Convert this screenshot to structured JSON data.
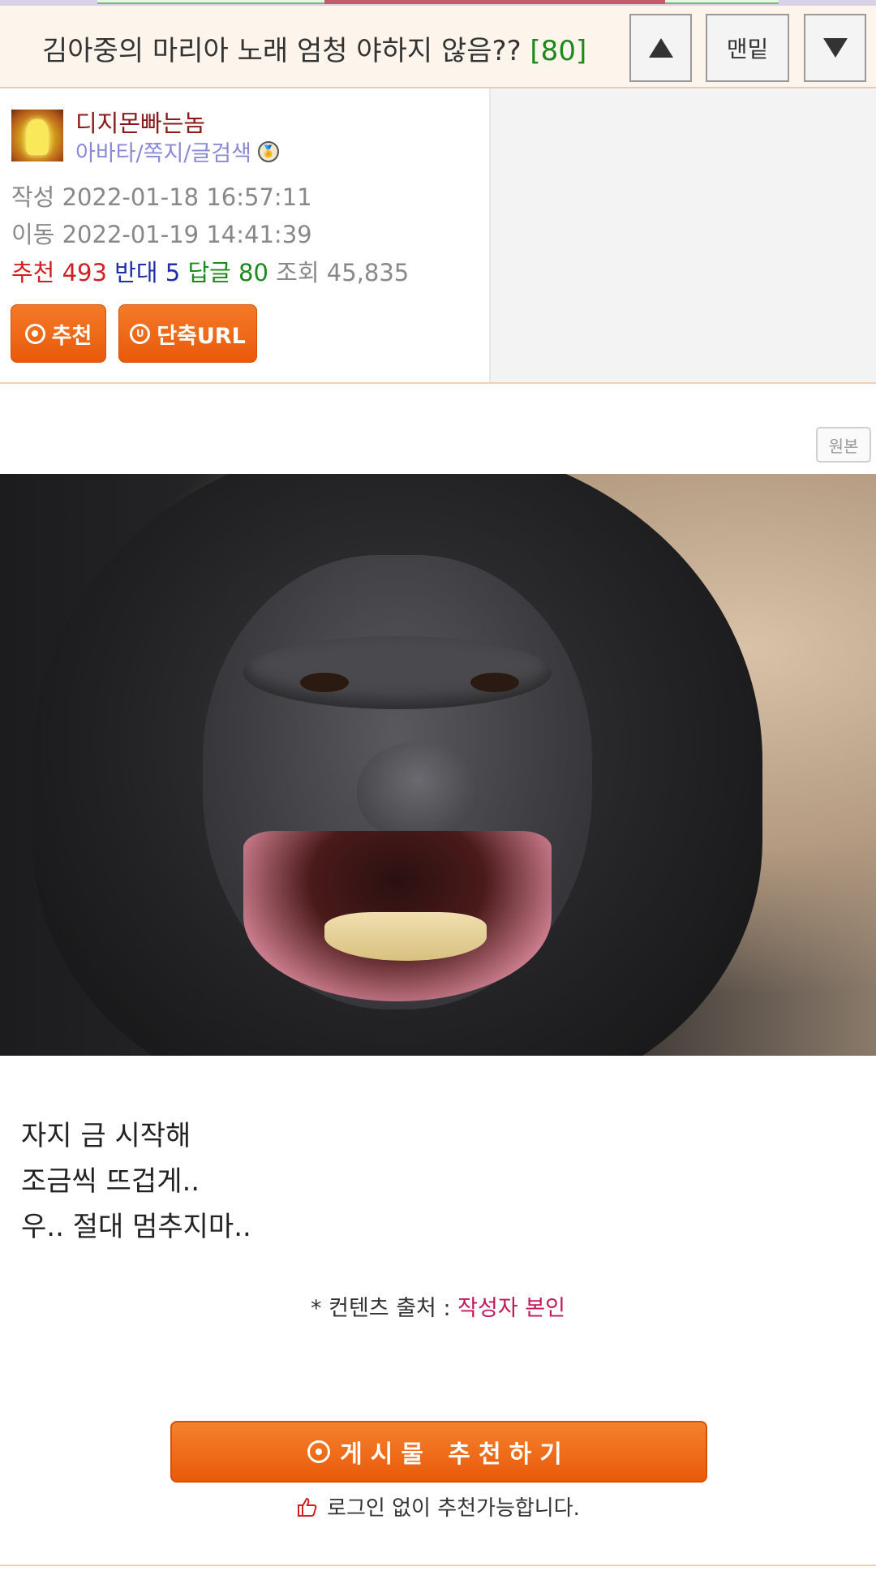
{
  "header": {
    "title": "김아중의 마리아 노래 엄청 야하지 않음??",
    "comment_count": "[80]",
    "bottom_label": "맨밑"
  },
  "author": {
    "name": "디지몬빠는놈",
    "links": "아바타/쪽지/글검색"
  },
  "meta": {
    "written_label": "작성",
    "written_value": "2022-01-18 16:57:11",
    "moved_label": "이동",
    "moved_value": "2022-01-19 14:41:39",
    "recommend_label": "추천",
    "recommend_value": "493",
    "oppose_label": "반대",
    "oppose_value": "5",
    "reply_label": "답글",
    "reply_value": "80",
    "views_label": "조회",
    "views_value": "45,835"
  },
  "buttons": {
    "recommend": "추천",
    "short_url": "단축URL",
    "short_url_icon_letter": "U",
    "original": "원본",
    "recommend_post": "게시물 추천하기"
  },
  "content": {
    "lines": [
      "자지 금 시작해",
      "조금씩 뜨겁게..",
      "우.. 절대 멈추지마.."
    ],
    "source_prefix": "* 컨텐츠 출처 :",
    "source_value": "작성자 본인"
  },
  "login_note": "로그인 없이 추천가능합니다.",
  "colors": {
    "accent_orange": "#e85a0a",
    "recommend_red": "#d21f1f",
    "oppose_blue": "#1f2fa8",
    "reply_green": "#1a8a1a",
    "author_name": "#8b1a1a",
    "link_purple": "#8a8ad6",
    "source_pink": "#c2185b"
  },
  "icons": {
    "up": "triangle-up",
    "down": "triangle-down",
    "medal": "medal-icon",
    "thumb": "thumbs-up-icon"
  }
}
